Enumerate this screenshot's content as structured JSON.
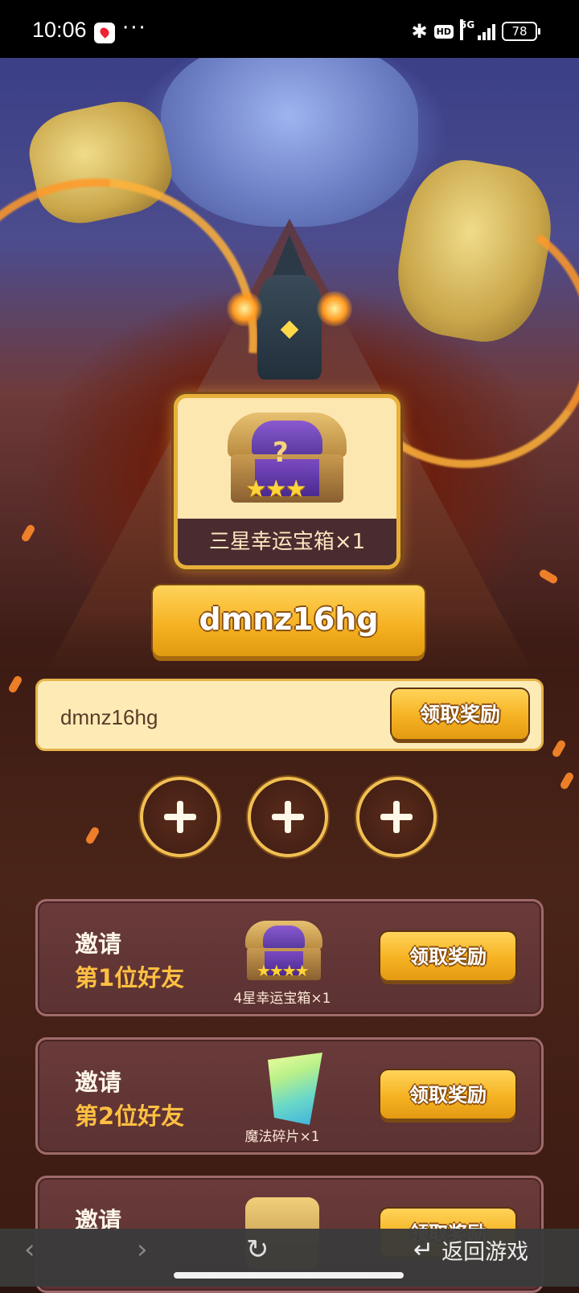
{
  "status_bar": {
    "time": "10:06",
    "more": "···",
    "bluetooth_icon": "bluetooth-icon",
    "hd_label": "HD",
    "network_label": "5G",
    "battery_level": "78"
  },
  "reward": {
    "name": "三星幸运宝箱×1",
    "chest_icon": "treasure-chest-icon"
  },
  "invite_code": "dmnz16hg",
  "code_input": {
    "value": "dmnz16hg"
  },
  "claim_button_label": "领取奖励",
  "friend_slots": [
    {
      "icon": "add-friend-icon"
    },
    {
      "icon": "add-friend-icon"
    },
    {
      "icon": "add-friend-icon"
    }
  ],
  "invite_rows": [
    {
      "line1": "邀请",
      "line2": "第1位好友",
      "reward_caption": "4星幸运宝箱×1",
      "button": "领取奖励",
      "reward_icon": "chest-icon"
    },
    {
      "line1": "邀请",
      "line2": "第2位好友",
      "reward_caption": "魔法碎片×1",
      "button": "领取奖励",
      "reward_icon": "crystal-shard-icon"
    },
    {
      "line1": "邀请",
      "line2": "",
      "reward_caption": "",
      "button": "领取奖励",
      "reward_icon": "golden-item-icon"
    }
  ],
  "bottom_nav": {
    "back_icon": "back-arrow-icon",
    "forward_icon": "forward-arrow-icon",
    "refresh_icon": "refresh-icon",
    "return_label": "返回游戏",
    "return_icon": "return-icon"
  },
  "colors": {
    "gold_accent": "#f6b222",
    "panel_bg": "#fdebb6",
    "row_bg": "#6a3a3a",
    "highlight_text": "#ffbf42"
  }
}
